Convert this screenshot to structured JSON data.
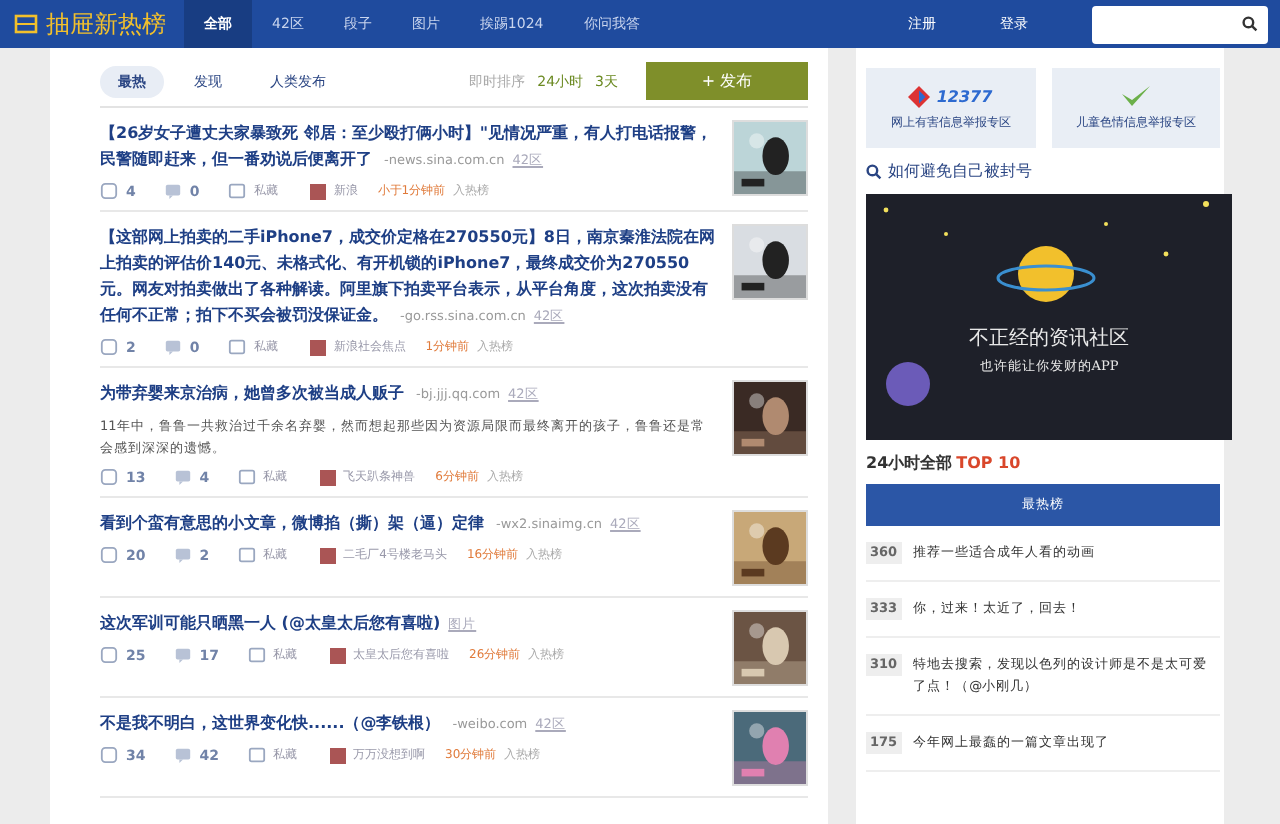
{
  "brand": "抽屉新热榜",
  "nav": [
    {
      "label": "全部",
      "selected": true
    },
    {
      "label": "42区",
      "selected": false
    },
    {
      "label": "段子",
      "selected": false
    },
    {
      "label": "图片",
      "selected": false
    },
    {
      "label": "挨踢1024",
      "selected": false
    },
    {
      "label": "你问我答",
      "selected": false
    }
  ],
  "auth": [
    "注册",
    "登录"
  ],
  "filters": [
    {
      "label": "最热",
      "selected": true
    },
    {
      "label": "发现",
      "selected": false
    },
    {
      "label": "人类发布",
      "selected": false
    }
  ],
  "sort": {
    "label": "即时排序",
    "options": [
      "24小时",
      "3天"
    ]
  },
  "publish": "+ 发布",
  "items": [
    {
      "title": "【26岁女子遭丈夫家暴致死 邻居：至少殴打俩小时】\"见情况严重，有人打电话报警，民警随即赶来，但一番劝说后便离开了",
      "source": "-news.sina.com.cn",
      "zone": "42区",
      "likes": "4",
      "comments": "0",
      "save": "私藏",
      "author": "新浪",
      "time": "小于1分钟前",
      "hot": "入热榜"
    },
    {
      "title": "【这部网上拍卖的二手iPhone7，成交价定格在270550元】8日，南京秦淮法院在网上拍卖的评估价140元、未格式化、有开机锁的iPhone7，最终成交价为270550元。网友对拍卖做出了各种解读。阿里旗下拍卖平台表示，从平台角度，这次拍卖没有任何不正常；拍下不买会被罚没保证金。",
      "source": "-go.rss.sina.com.cn",
      "zone": "42区",
      "likes": "2",
      "comments": "0",
      "save": "私藏",
      "author": "新浪社会焦点",
      "time": "1分钟前",
      "hot": "入热榜"
    },
    {
      "title": "为带弃婴来京治病，她曾多次被当成人贩子",
      "source": "-bj.jjj.qq.com",
      "zone": "42区",
      "summary": "11年中，鲁鲁一共救治过千余名弃婴，然而想起那些因为资源局限而最终离开的孩子，鲁鲁还是常会感到深深的遗憾。",
      "likes": "13",
      "comments": "4",
      "save": "私藏",
      "author": "飞天趴条神兽",
      "time": "6分钟前",
      "hot": "入热榜"
    },
    {
      "title": "看到个蛮有意思的小文章，微博掐（撕）架（逼）定律",
      "source": "-wx2.sinaimg.cn",
      "zone": "42区",
      "likes": "20",
      "comments": "2",
      "save": "私藏",
      "author": "二毛厂4号楼老马头",
      "time": "16分钟前",
      "hot": "入热榜"
    },
    {
      "title": "这次军训可能只晒黑一人 (@太皇太后您有喜啦)",
      "zone": "图片",
      "likes": "25",
      "comments": "17",
      "save": "私藏",
      "author": "太皇太后您有喜啦",
      "time": "26分钟前",
      "hot": "入热榜"
    },
    {
      "title": "不是我不明白，这世界变化快......（@李铁根）",
      "source": "-weibo.com",
      "zone": "42区",
      "likes": "34",
      "comments": "42",
      "save": "私藏",
      "author": "万万没想到啊",
      "time": "30分钟前",
      "hot": "入热榜"
    }
  ],
  "report": [
    {
      "logo": "12377",
      "label": "网上有害信息举报专区"
    },
    {
      "label": "儿童色情信息举报专区"
    }
  ],
  "help_link": "如何避免自己被封号",
  "banner": {
    "headline": "不正经的资讯社区",
    "tagline": "也许能让你发财的APP"
  },
  "top": {
    "prefix": "24小时全部",
    "suffix": "TOP 10",
    "tab": "最热榜"
  },
  "hot": [
    {
      "count": "360",
      "title": "推荐一些适合成年人看的动画"
    },
    {
      "count": "333",
      "title": "你，过来！太近了，回去！"
    },
    {
      "count": "310",
      "title": "特地去搜索，发现以色列的设计师是不是太可爱了点！（@小刚几）"
    },
    {
      "count": "175",
      "title": "今年网上最蠢的一篇文章出现了"
    }
  ]
}
